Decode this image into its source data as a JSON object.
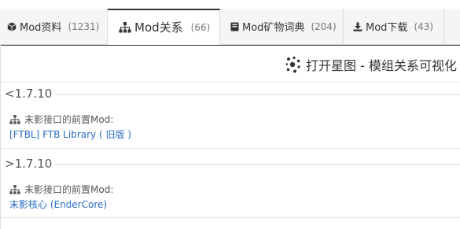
{
  "tabs": [
    {
      "label": "Mod资料",
      "count": "(1231)",
      "icon": "cube-icon"
    },
    {
      "label": "Mod关系",
      "count": "(66)",
      "icon": "sitemap-icon",
      "active": true
    },
    {
      "label": "Mod矿物词典",
      "count": "(204)",
      "icon": "book-icon"
    },
    {
      "label": "Mod下载",
      "count": "(43)",
      "icon": "download-icon"
    }
  ],
  "graph_link": {
    "label": "打开星图 - 模组关系可视化",
    "icon": "star-graph-icon"
  },
  "sections": [
    {
      "version": "<1.7.10",
      "dependency_label": "末影接口的前置Mod:",
      "mods": [
        "[FTBL] FTB Library ( 旧版 )"
      ]
    },
    {
      "version": ">1.7.10",
      "dependency_label": "末影接口的前置Mod:",
      "mods": [
        "末影核心 (EnderCore)"
      ]
    }
  ],
  "colors": {
    "link": "#2a6dc2",
    "text": "#333333",
    "border": "#dddddd"
  }
}
